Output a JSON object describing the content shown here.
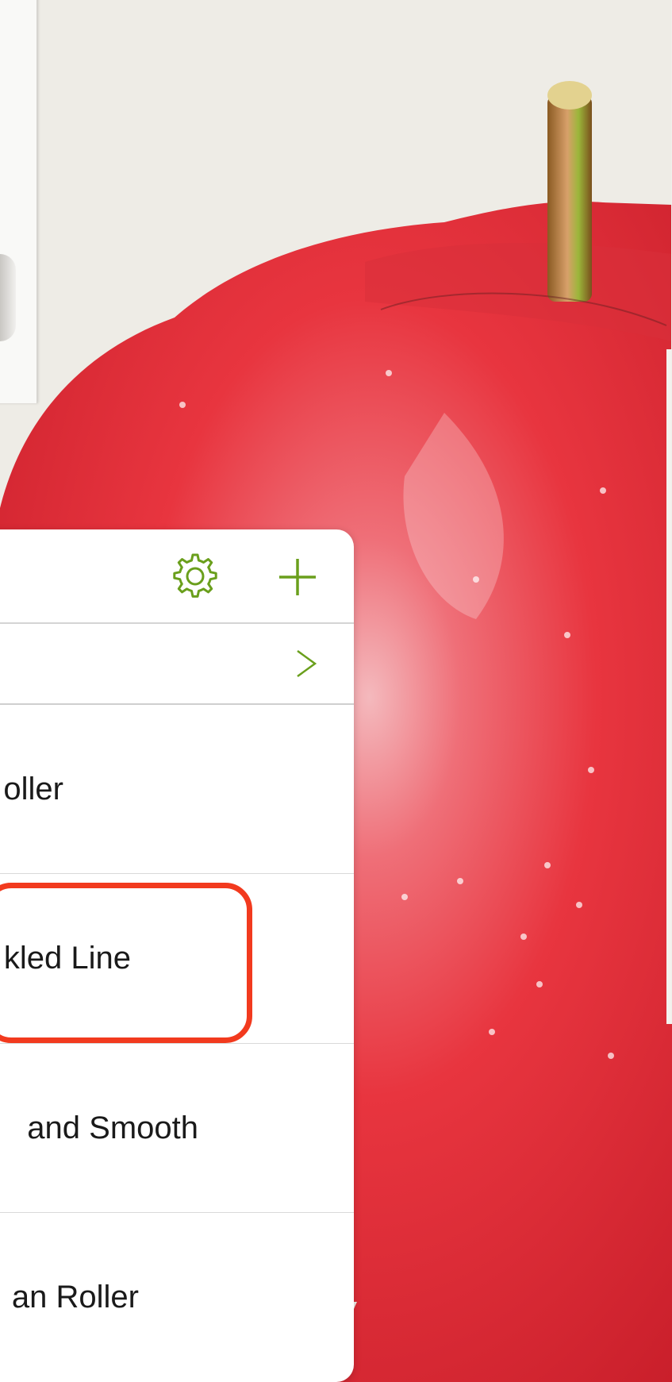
{
  "brush_panel": {
    "items": [
      {
        "label": "oller"
      },
      {
        "label": "kled Line"
      },
      {
        "label": "and Smooth"
      },
      {
        "label": "an Roller"
      }
    ]
  },
  "colors": {
    "accent": "#6a9f1c",
    "highlight": "#f23a1e",
    "apple": "#e8303b"
  },
  "icons": [
    "gear-icon",
    "add-icon",
    "chevron-right-icon"
  ]
}
